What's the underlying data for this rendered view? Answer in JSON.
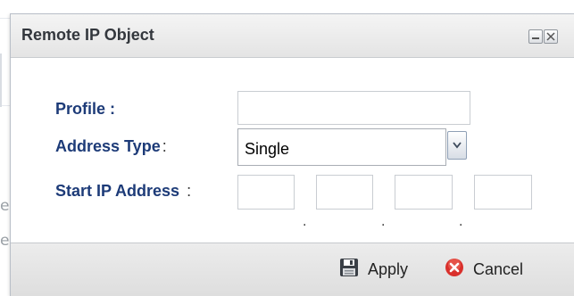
{
  "background": {
    "edge_letters": [
      "e",
      "e"
    ]
  },
  "dialog": {
    "title": "Remote IP Object",
    "controls": {
      "minimize_icon": "minimize-icon",
      "close_icon": "close-icon"
    },
    "form": {
      "profile": {
        "label": "Profile :",
        "value": ""
      },
      "address_type": {
        "label": "Address Type",
        "colon": ":",
        "selected": "Single"
      },
      "start_ip": {
        "label": "Start IP Address",
        "colon": ":",
        "octets": [
          "",
          "",
          "",
          ""
        ],
        "separator": "."
      }
    },
    "footer": {
      "apply_label": "Apply",
      "cancel_label": "Cancel",
      "apply_icon": "floppy-disk-icon",
      "cancel_icon": "red-x-circle-icon"
    }
  },
  "colors": {
    "label": "#1d3b78",
    "cancel_icon": "#d9302c"
  }
}
